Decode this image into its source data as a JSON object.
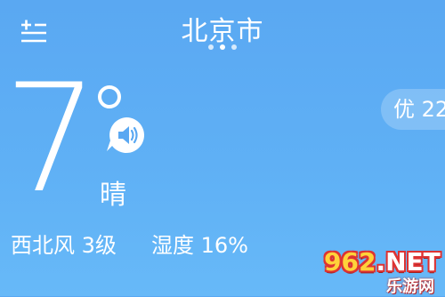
{
  "header": {
    "city": "北京市",
    "page_dots": [
      {
        "active": false
      },
      {
        "active": true
      },
      {
        "active": false
      }
    ],
    "menu_icon": "add-list-icon"
  },
  "current": {
    "temperature": "7",
    "unit_icon": "degree-icon",
    "condition": "晴",
    "voice_icon": "speaker-icon",
    "wind": "西北风 3级",
    "humidity": "湿度 16%"
  },
  "air_quality": {
    "label": "优 22"
  },
  "watermark": {
    "main": "962",
    "suffix": ".NET",
    "sub": "乐游网"
  },
  "colors": {
    "background_top": "#5aa8f2",
    "background_bottom": "#67b9f8",
    "text": "#ffffff"
  }
}
